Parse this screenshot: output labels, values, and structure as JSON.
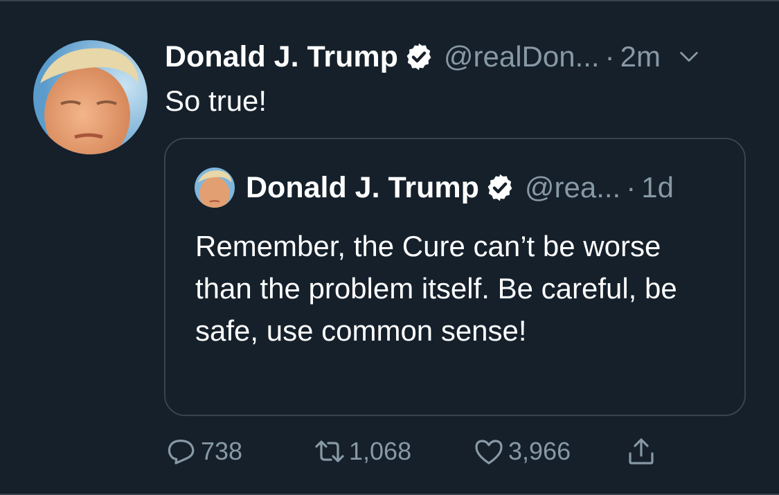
{
  "tweet": {
    "author_name": "Donald J. Trump",
    "handle": "@realDon...",
    "separator": "·",
    "time": "2m",
    "text": "So true!",
    "verified_icon": "verified-badge-icon",
    "menu_icon": "chevron-down-icon"
  },
  "quoted_tweet": {
    "author_name": "Donald J. Trump",
    "handle": "@rea...",
    "separator": "·",
    "time": "1d",
    "text": "Remember, the Cure can’t be worse than the problem itself. Be careful, be safe, use common sense!"
  },
  "actions": {
    "reply_count": "738",
    "retweet_count": "1,068",
    "like_count": "3,966"
  },
  "colors": {
    "background": "#15202b",
    "secondary_text": "#8899a6",
    "border": "#38444d"
  }
}
